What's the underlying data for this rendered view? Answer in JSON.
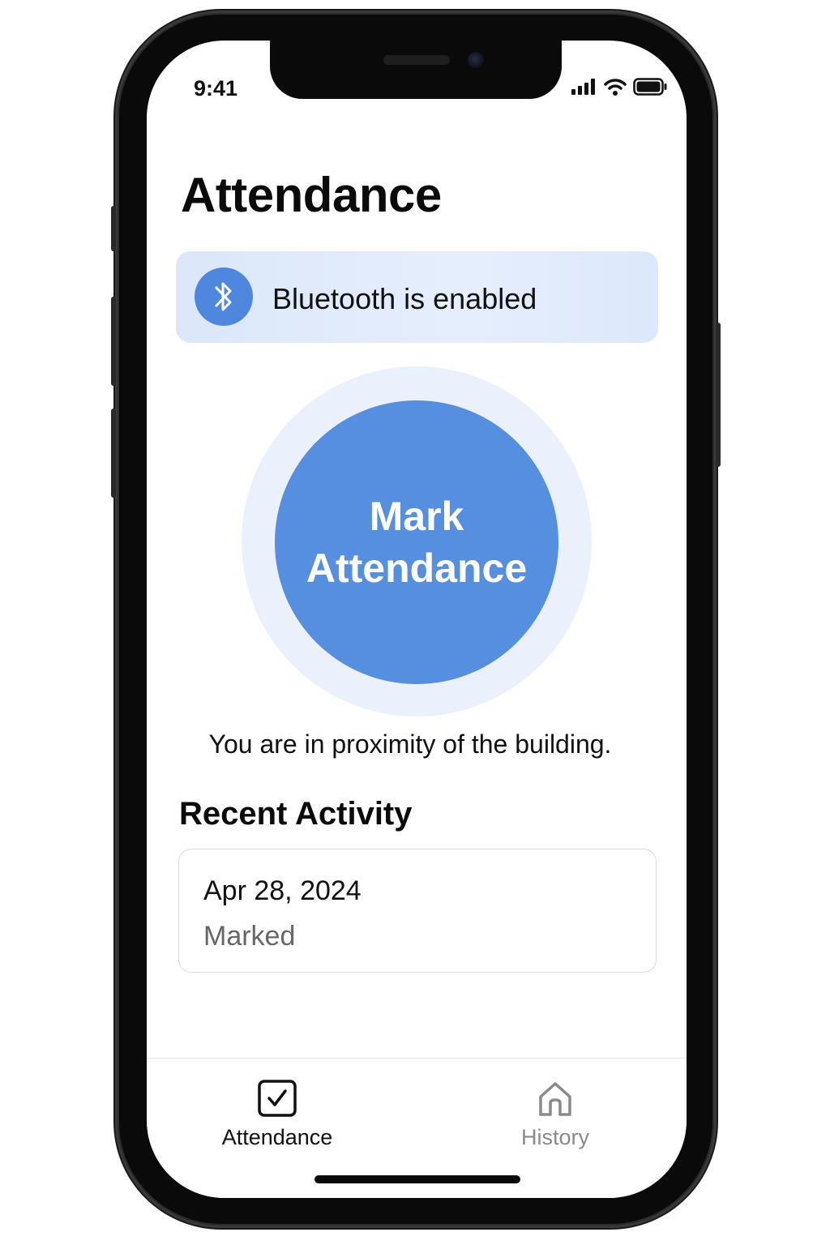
{
  "status_bar": {
    "time": "9:41",
    "icons": [
      "signal-icon",
      "wifi-icon",
      "battery-icon"
    ]
  },
  "page": {
    "title": "Attendance"
  },
  "bluetooth_banner": {
    "icon": "bluetooth-icon",
    "text": "Bluetooth is enabled",
    "background": "#dde8fb",
    "icon_color": "#4f87de"
  },
  "mark_button": {
    "line1": "Mark",
    "line2": "Attendance",
    "color": "#568ee0"
  },
  "proximity_text": "You are in proximity of the building.",
  "recent_activity": {
    "title": "Recent Activity",
    "items": [
      {
        "date": "Apr 28, 2024",
        "status": "Marked"
      }
    ]
  },
  "tab_bar": {
    "tabs": [
      {
        "label": "Attendance",
        "icon": "checkbox-icon",
        "active": true
      },
      {
        "label": "History",
        "icon": "home-icon",
        "active": false
      }
    ]
  }
}
